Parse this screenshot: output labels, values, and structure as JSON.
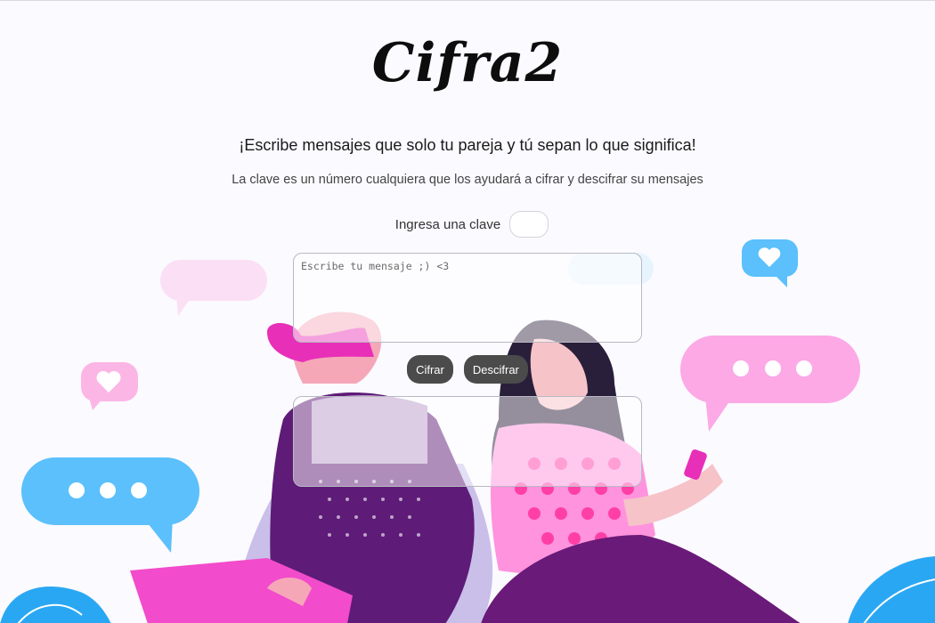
{
  "app": {
    "logo_text": "Cifra2"
  },
  "header": {
    "headline": "¡Escribe mensajes que solo tu pareja y tú sepan lo que significa!",
    "subtitle": "La clave es un número cualquiera que los ayudará a cifrar y descifrar su mensajes"
  },
  "key": {
    "label": "Ingresa una clave",
    "value": ""
  },
  "message": {
    "placeholder": "Escribe tu mensaje ;) <3",
    "value": ""
  },
  "buttons": {
    "cipher_label": "Cifrar",
    "decipher_label": "Descifrar"
  },
  "output": {
    "value": ""
  },
  "colors": {
    "background": "#fbfaff",
    "button": "#4b4b4b",
    "pink_bubble": "#fca9e6",
    "blue_bubble": "#5bc0fb",
    "magenta": "#e82fb7",
    "purple": "#6a1a78"
  }
}
